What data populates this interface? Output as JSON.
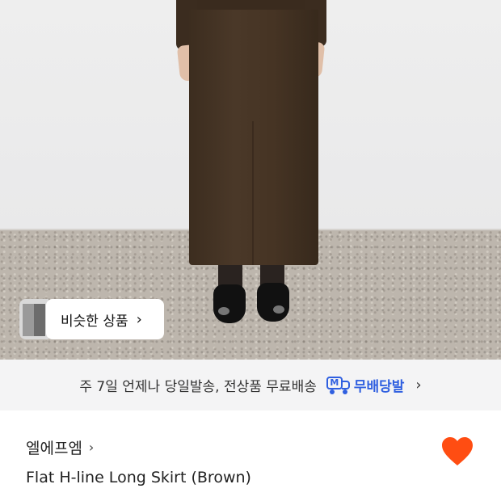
{
  "similar_products": {
    "label": "비슷한 상품",
    "chevron": "chevron-right-icon"
  },
  "shipping_banner": {
    "text": "주 7일 언제나 당일발송, 전상품 무료배송",
    "badge_icon": "truck-icon",
    "badge_icon_letter": "M",
    "badge_label": "무배당발",
    "accent_color": "#2f5fe0"
  },
  "product": {
    "brand": "엘에프엠",
    "name": "Flat H-line Long Skirt (Brown)",
    "wishlist_icon": "heart-icon",
    "wishlist_color": "#ff4d12"
  }
}
